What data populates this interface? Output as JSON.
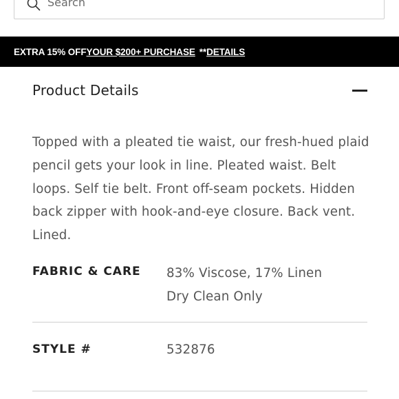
{
  "search": {
    "placeholder": "Search"
  },
  "promo": {
    "prefix": "EXTRA 15% OFF",
    "link": "YOUR $200+ PURCHASE",
    "suffix": "**",
    "details_link": "DETAILS"
  },
  "product_details": {
    "title": "Product Details",
    "toggle_icon": "minus-icon",
    "description": "Topped with a pleated tie waist, our fresh-hued plaid pencil gets your look in line. Pleated waist. Belt loops. Self tie belt. Front off-seam pockets. Hidden back zipper with hook-and-eye closure. Back vent. Lined.",
    "specs": [
      {
        "label": "FABRIC & CARE",
        "values": [
          "83% Viscose, 17% Linen",
          "Dry Clean Only"
        ]
      },
      {
        "label": "STYLE #",
        "values": [
          "532876"
        ]
      }
    ]
  },
  "colors": {
    "banner_bg": "#000000",
    "text_primary": "#222222",
    "text_secondary": "#555555",
    "divider": "#cfcfcf"
  }
}
